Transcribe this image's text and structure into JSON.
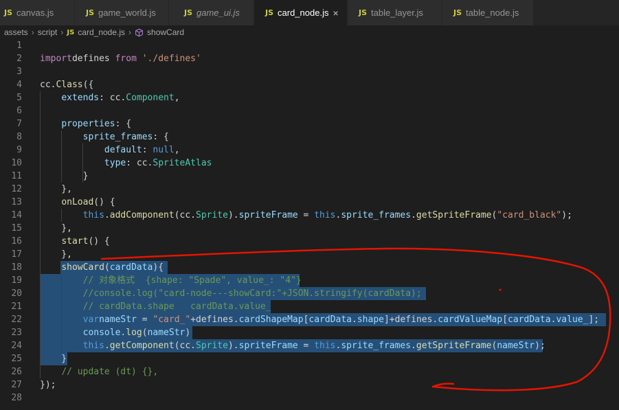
{
  "tabs": [
    {
      "badge": "JS",
      "label": "canvas.js",
      "active": false,
      "italic": false
    },
    {
      "badge": "JS",
      "label": "game_world.js",
      "active": false,
      "italic": false
    },
    {
      "badge": "JS",
      "label": "game_ui.js",
      "active": false,
      "italic": true
    },
    {
      "badge": "JS",
      "label": "card_node.js",
      "active": true,
      "italic": false,
      "close": "×"
    },
    {
      "badge": "JS",
      "label": "table_layer.js",
      "active": false,
      "italic": false
    },
    {
      "badge": "JS",
      "label": "table_node.js",
      "active": false,
      "italic": false
    }
  ],
  "breadcrumb": {
    "folder1": "assets",
    "folder2": "script",
    "file_badge": "JS",
    "file": "card_node.js",
    "symbol": "showCard",
    "separator": "›"
  },
  "colors": {
    "accent_selection": "#264f78",
    "annotation_red": "#e51400",
    "js_badge": "#cbcb41"
  },
  "lines": [
    {
      "n": "1",
      "tokens": []
    },
    {
      "n": "2",
      "tokens": [
        [
          "kw2",
          "import"
        ],
        [
          "",
          "defines "
        ],
        [
          "kw2",
          "from"
        ],
        [
          "",
          " "
        ],
        [
          "str",
          "'./defines'"
        ]
      ]
    },
    {
      "n": "3",
      "tokens": []
    },
    {
      "n": "4",
      "tokens": [
        [
          "",
          "cc."
        ],
        [
          "fn",
          "Class"
        ],
        [
          "",
          "({"
        ]
      ]
    },
    {
      "n": "5",
      "tokens": [
        [
          "",
          "    "
        ],
        [
          "prop",
          "extends"
        ],
        [
          "",
          ": cc."
        ],
        [
          "type",
          "Component"
        ],
        [
          "",
          ","
        ]
      ]
    },
    {
      "n": "6",
      "tokens": []
    },
    {
      "n": "7",
      "tokens": [
        [
          "",
          "    "
        ],
        [
          "prop",
          "properties"
        ],
        [
          "",
          ": {"
        ]
      ]
    },
    {
      "n": "8",
      "tokens": [
        [
          "",
          "        "
        ],
        [
          "prop",
          "sprite_frames"
        ],
        [
          "",
          ": {"
        ]
      ]
    },
    {
      "n": "9",
      "tokens": [
        [
          "",
          "            "
        ],
        [
          "prop",
          "default"
        ],
        [
          "",
          ": "
        ],
        [
          "kw",
          "null"
        ],
        [
          "",
          ","
        ]
      ]
    },
    {
      "n": "10",
      "tokens": [
        [
          "",
          "            "
        ],
        [
          "prop",
          "type"
        ],
        [
          "",
          ": cc."
        ],
        [
          "type",
          "SpriteAtlas"
        ]
      ]
    },
    {
      "n": "11",
      "tokens": [
        [
          "",
          "        }"
        ]
      ]
    },
    {
      "n": "12",
      "tokens": [
        [
          "",
          "    },"
        ]
      ]
    },
    {
      "n": "13",
      "tokens": [
        [
          "",
          "    "
        ],
        [
          "fn",
          "onLoad"
        ],
        [
          "",
          "() {"
        ]
      ]
    },
    {
      "n": "14",
      "tokens": [
        [
          "",
          "        "
        ],
        [
          "kw",
          "this"
        ],
        [
          "",
          "."
        ],
        [
          "fn",
          "addComponent"
        ],
        [
          "",
          "(cc."
        ],
        [
          "type",
          "Sprite"
        ],
        [
          "",
          ")."
        ],
        [
          "prop",
          "spriteFrame"
        ],
        [
          "",
          " = "
        ],
        [
          "kw",
          "this"
        ],
        [
          "",
          "."
        ],
        [
          "prop",
          "sprite_frames"
        ],
        [
          "",
          "."
        ],
        [
          "fn",
          "getSpriteFrame"
        ],
        [
          "",
          "("
        ],
        [
          "str",
          "\"card_black\""
        ],
        [
          "",
          ");"
        ]
      ]
    },
    {
      "n": "15",
      "tokens": [
        [
          "",
          "    },"
        ]
      ]
    },
    {
      "n": "16",
      "tokens": [
        [
          "",
          "    "
        ],
        [
          "fn",
          "start"
        ],
        [
          "",
          "() {"
        ]
      ]
    },
    {
      "n": "17",
      "tokens": [
        [
          "",
          "    },"
        ]
      ]
    },
    {
      "n": "18",
      "tokens": [
        [
          "",
          "    "
        ],
        [
          "fn",
          "showCard"
        ],
        [
          "",
          "("
        ],
        [
          "prop",
          "cardData"
        ],
        [
          "",
          "){"
        ]
      ]
    },
    {
      "n": "19",
      "tokens": [
        [
          "",
          "        "
        ],
        [
          "cm",
          "// 对象格式  {shape: \"Spade\", value_: \"4\"}"
        ]
      ]
    },
    {
      "n": "20",
      "tokens": [
        [
          "",
          "        "
        ],
        [
          "cm",
          "//console.log(\"card-node---showCard:\"+JSON.stringify(cardData);"
        ]
      ]
    },
    {
      "n": "21",
      "tokens": [
        [
          "",
          "        "
        ],
        [
          "cm",
          "// cardData.shape   cardData.value_"
        ]
      ]
    },
    {
      "n": "22",
      "tokens": [
        [
          "",
          "        "
        ],
        [
          "kw",
          "var"
        ],
        [
          "",
          "",
          " "
        ],
        [
          "prop",
          "nameStr"
        ],
        [
          "",
          " = "
        ],
        [
          "str",
          "\"card_\""
        ],
        [
          "",
          "+defines."
        ],
        [
          "prop",
          "cardShapeMap"
        ],
        [
          "",
          "["
        ],
        [
          "prop",
          "cardData"
        ],
        [
          "",
          "."
        ],
        [
          "prop",
          "shape"
        ],
        [
          "",
          "]+defines."
        ],
        [
          "prop",
          "cardValueMap"
        ],
        [
          "",
          "["
        ],
        [
          "prop",
          "cardData"
        ],
        [
          "",
          "."
        ],
        [
          "prop",
          "value_"
        ],
        [
          "",
          "];"
        ]
      ]
    },
    {
      "n": "23",
      "tokens": [
        [
          "",
          "        "
        ],
        [
          "prop",
          "console"
        ],
        [
          "",
          "."
        ],
        [
          "fn",
          "log"
        ],
        [
          "",
          "("
        ],
        [
          "prop",
          "nameStr"
        ],
        [
          "",
          ")"
        ]
      ]
    },
    {
      "n": "24",
      "tokens": [
        [
          "",
          "        "
        ],
        [
          "kw",
          "this"
        ],
        [
          "",
          "."
        ],
        [
          "fn",
          "getComponent"
        ],
        [
          "",
          "(cc."
        ],
        [
          "type",
          "Sprite"
        ],
        [
          "",
          ")."
        ],
        [
          "prop",
          "spriteFrame"
        ],
        [
          "",
          " = "
        ],
        [
          "kw",
          "this"
        ],
        [
          "",
          "."
        ],
        [
          "prop",
          "sprite_frames"
        ],
        [
          "",
          "."
        ],
        [
          "fn",
          "getSpriteFrame"
        ],
        [
          "",
          "("
        ],
        [
          "prop",
          "nameStr"
        ],
        [
          "",
          ");"
        ]
      ]
    },
    {
      "n": "25",
      "tokens": [
        [
          "",
          "    }"
        ]
      ]
    },
    {
      "n": "26",
      "tokens": [
        [
          "",
          "    "
        ],
        [
          "cm",
          "// update (dt) {},"
        ]
      ]
    },
    {
      "n": "27",
      "tokens": [
        [
          "",
          "});"
        ]
      ]
    },
    {
      "n": "28",
      "tokens": []
    }
  ]
}
